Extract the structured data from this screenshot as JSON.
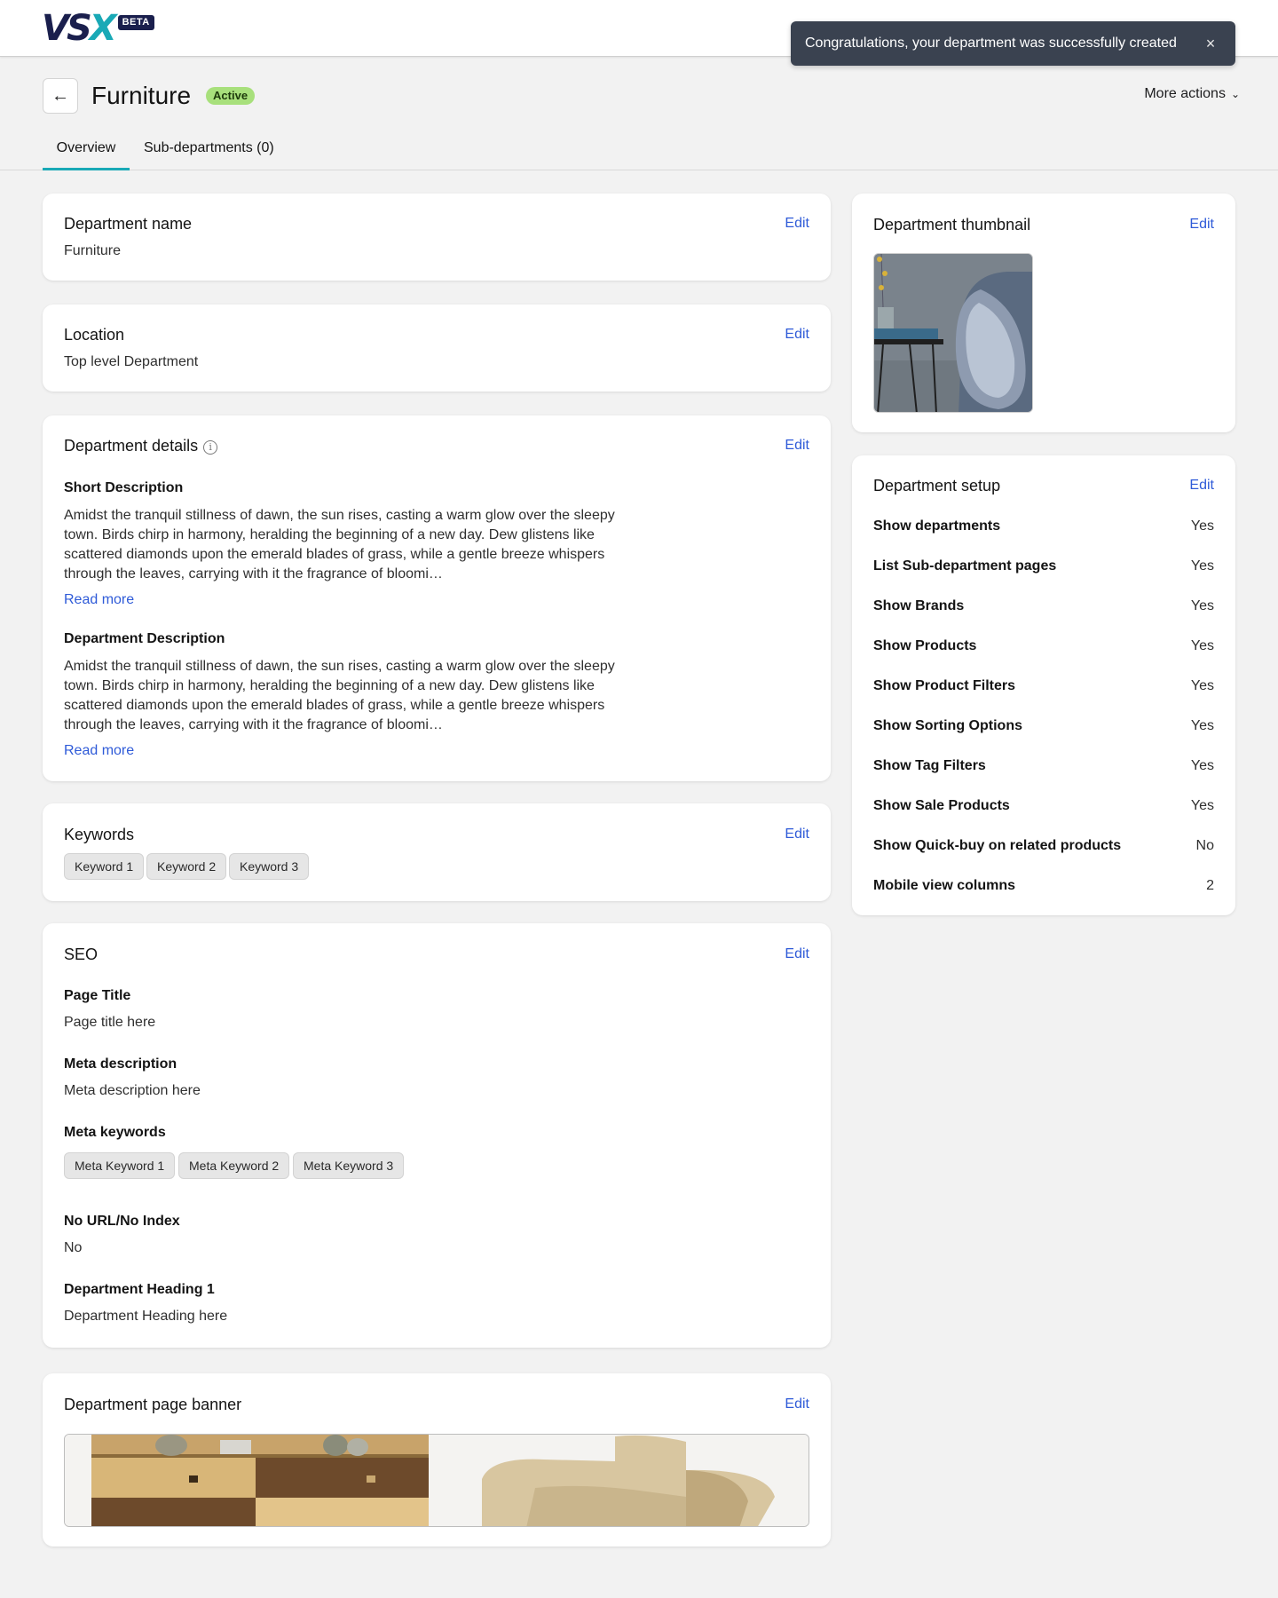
{
  "logo": {
    "text_main": "VS",
    "text_x": "X",
    "badge": "BETA"
  },
  "toast": {
    "message": "Congratulations, your department was successfully created",
    "close": "×"
  },
  "header": {
    "back": "←",
    "title": "Furniture",
    "status": "Active",
    "more_actions": "More actions",
    "more_chevron": "⌄"
  },
  "tabs": [
    {
      "label": "Overview",
      "active": true
    },
    {
      "label": "Sub-departments (0)",
      "active": false
    }
  ],
  "edit_label": "Edit",
  "department_name": {
    "title": "Department name",
    "value": "Furniture"
  },
  "location": {
    "title": "Location",
    "value": "Top level Department"
  },
  "details": {
    "title": "Department details",
    "info_icon": "i",
    "short_label": "Short Description",
    "short_text": "Amidst the tranquil stillness of dawn, the sun rises, casting a warm glow over the sleepy town. Birds chirp in harmony, heralding the beginning of a new day. Dew glistens like scattered diamonds upon the emerald blades of grass, while a gentle breeze whispers through the leaves, carrying with it the fragrance of bloomi…",
    "read_more": "Read more",
    "dept_label": "Department Description",
    "dept_text": "Amidst the tranquil stillness of dawn, the sun rises, casting a warm glow over the sleepy town. Birds chirp in harmony, heralding the beginning of a new day. Dew glistens like scattered diamonds upon the emerald blades of grass, while a gentle breeze whispers through the leaves, carrying with it the fragrance of bloomi…"
  },
  "keywords": {
    "title": "Keywords",
    "items": [
      "Keyword 1",
      "Keyword 2",
      "Keyword 3"
    ]
  },
  "seo": {
    "title": "SEO",
    "page_title_label": "Page Title",
    "page_title_value": "Page title here",
    "meta_desc_label": "Meta description",
    "meta_desc_value": "Meta description here",
    "meta_keywords_label": "Meta keywords",
    "meta_keywords": [
      "Meta Keyword 1",
      "Meta Keyword 2",
      "Meta Keyword 3"
    ],
    "no_url_label": "No URL/No Index",
    "no_url_value": "No",
    "heading_label": "Department Heading 1",
    "heading_value": "Department Heading here"
  },
  "banner": {
    "title": "Department page banner"
  },
  "thumbnail": {
    "title": "Department thumbnail"
  },
  "setup": {
    "title": "Department setup",
    "rows": [
      {
        "label": "Show departments",
        "value": "Yes"
      },
      {
        "label": "List Sub-department pages",
        "value": "Yes"
      },
      {
        "label": "Show Brands",
        "value": "Yes"
      },
      {
        "label": "Show Products",
        "value": "Yes"
      },
      {
        "label": "Show Product Filters",
        "value": "Yes"
      },
      {
        "label": "Show Sorting Options",
        "value": "Yes"
      },
      {
        "label": "Show Tag Filters",
        "value": "Yes"
      },
      {
        "label": "Show Sale Products",
        "value": "Yes"
      },
      {
        "label": "Show Quick-buy on related products",
        "value": "No"
      },
      {
        "label": "Mobile view columns",
        "value": "2"
      }
    ]
  },
  "colors": {
    "accent": "#19a9b6",
    "link": "#2f5bd8",
    "status_bg": "#a8e07c",
    "toast_bg": "#3a4250",
    "page_bg": "#f2f2f2"
  }
}
